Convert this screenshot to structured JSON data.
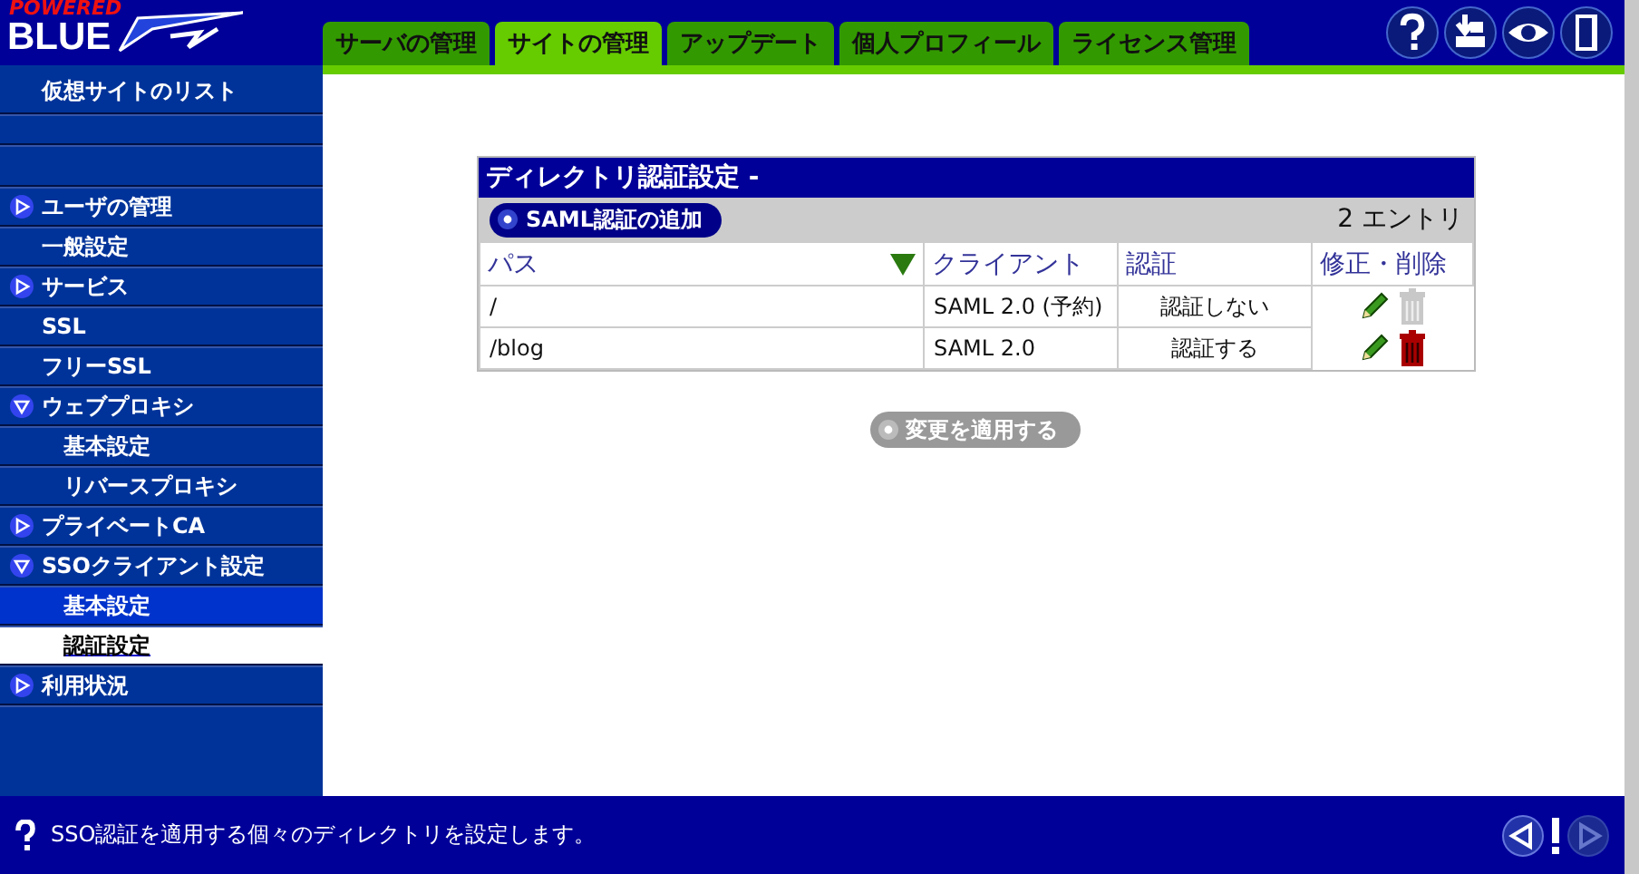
{
  "logo": {
    "top": "POWERED",
    "main": "BLUE"
  },
  "tabs": [
    {
      "label": "サーバの管理",
      "selected": false
    },
    {
      "label": "サイトの管理",
      "selected": true
    },
    {
      "label": "アップデート",
      "selected": false
    },
    {
      "label": "個人プロフィール",
      "selected": false
    },
    {
      "label": "ライセンス管理",
      "selected": false
    }
  ],
  "sidebar": {
    "items": [
      {
        "label": "仮想サイトのリスト",
        "kind": "title",
        "selected": false
      },
      {
        "label": "ユーザの管理",
        "kind": "group",
        "expanded": false,
        "selected": false
      },
      {
        "label": "一般設定",
        "kind": "link",
        "selected": false
      },
      {
        "label": "サービス",
        "kind": "group",
        "expanded": false,
        "selected": false
      },
      {
        "label": "SSL",
        "kind": "link",
        "selected": false
      },
      {
        "label": "フリーSSL",
        "kind": "link",
        "selected": false
      },
      {
        "label": "ウェブプロキシ",
        "kind": "group",
        "expanded": true,
        "selected": false,
        "children": [
          {
            "label": "基本設定",
            "selected": false,
            "highlighted": false
          },
          {
            "label": "リバースプロキシ",
            "selected": false,
            "highlighted": false
          }
        ]
      },
      {
        "label": "プライベートCA",
        "kind": "group",
        "expanded": false,
        "selected": false
      },
      {
        "label": "SSOクライアント設定",
        "kind": "group",
        "expanded": true,
        "selected": false,
        "children": [
          {
            "label": "基本設定",
            "selected": false,
            "highlighted": true
          },
          {
            "label": "認証設定",
            "selected": true,
            "highlighted": false
          }
        ]
      },
      {
        "label": "利用状況",
        "kind": "group",
        "expanded": false,
        "selected": false
      }
    ]
  },
  "panel": {
    "title": "ディレクトリ認証設定 -",
    "add_button": "SAML認証の追加",
    "count": "2 エントリ",
    "columns": [
      {
        "label": "パス",
        "sorted": true
      },
      {
        "label": "クライアント",
        "sorted": false
      },
      {
        "label": "認証",
        "sorted": false
      },
      {
        "label": "修正・削除",
        "sorted": false
      }
    ],
    "rows": [
      {
        "path": "/",
        "client": "SAML 2.0 (予約)",
        "auth": "認証しない",
        "deletable": false
      },
      {
        "path": "/blog",
        "client": "SAML 2.0",
        "auth": "認証する",
        "deletable": true
      }
    ]
  },
  "apply_button": {
    "label": "変更を適用する",
    "disabled": true
  },
  "status_bar": {
    "message": "SSO認証を適用する個々のディレクトリを設定します。"
  }
}
